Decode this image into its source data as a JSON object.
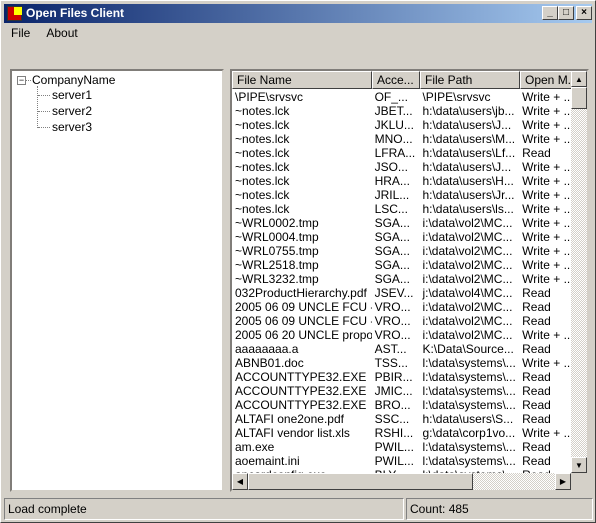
{
  "window": {
    "title": "Open Files Client"
  },
  "menu": [
    {
      "label": "File"
    },
    {
      "label": "About"
    }
  ],
  "tree": {
    "root": "CompanyName",
    "children": [
      "server1",
      "server2",
      "server3"
    ]
  },
  "list": {
    "columns": [
      "File Name",
      "Acce...",
      "File Path",
      "Open M..."
    ],
    "rows": [
      [
        "\\PIPE\\srvsvc",
        "OF_...",
        "\\PIPE\\srvsvc",
        "Write + ..."
      ],
      [
        "~notes.lck",
        "JBET...",
        "h:\\data\\users\\jb...",
        "Write + ..."
      ],
      [
        "~notes.lck",
        "JKLU...",
        "h:\\data\\users\\J...",
        "Write + ..."
      ],
      [
        "~notes.lck",
        "MNO...",
        "h:\\data\\users\\M...",
        "Write + ..."
      ],
      [
        "~notes.lck",
        "LFRA...",
        "h:\\data\\users\\Lf...",
        "Read"
      ],
      [
        "~notes.lck",
        "JSO...",
        "h:\\data\\users\\J...",
        "Write + ..."
      ],
      [
        "~notes.lck",
        "HRA...",
        "h:\\data\\users\\H...",
        "Write + ..."
      ],
      [
        "~notes.lck",
        "JRIL...",
        "h:\\data\\users\\Jr...",
        "Write + ..."
      ],
      [
        "~notes.lck",
        "LSC...",
        "h:\\data\\users\\ls...",
        "Write + ..."
      ],
      [
        "~WRL0002.tmp",
        "SGA...",
        "i:\\data\\vol2\\MC...",
        "Write + ..."
      ],
      [
        "~WRL0004.tmp",
        "SGA...",
        "i:\\data\\vol2\\MC...",
        "Write + ..."
      ],
      [
        "~WRL0755.tmp",
        "SGA...",
        "i:\\data\\vol2\\MC...",
        "Write + ..."
      ],
      [
        "~WRL2518.tmp",
        "SGA...",
        "i:\\data\\vol2\\MC...",
        "Write + ..."
      ],
      [
        "~WRL3232.tmp",
        "SGA...",
        "i:\\data\\vol2\\MC...",
        "Write + ..."
      ],
      [
        "032ProductHierarchy.pdf",
        "JSEV...",
        "j:\\data\\vol4\\MC...",
        "Read"
      ],
      [
        "2005 06 09 UNCLE FCU -...",
        "VRO...",
        "i:\\data\\vol2\\MC...",
        "Read"
      ],
      [
        "2005 06 09 UNCLE FCU -...",
        "VRO...",
        "i:\\data\\vol2\\MC...",
        "Read"
      ],
      [
        "2005 06 20 UNCLE propo...",
        "VRO...",
        "i:\\data\\vol2\\MC...",
        "Write + ..."
      ],
      [
        "aaaaaaaa.a",
        "AST...",
        "K:\\Data\\Source...",
        "Read"
      ],
      [
        "ABNB01.doc",
        "TSS...",
        "l:\\data\\systems\\...",
        "Write + ..."
      ],
      [
        "ACCOUNTTYPE32.EXE",
        "PBIR...",
        "l:\\data\\systems\\...",
        "Read"
      ],
      [
        "ACCOUNTTYPE32.EXE",
        "JMIC...",
        "l:\\data\\systems\\...",
        "Read"
      ],
      [
        "ACCOUNTTYPE32.EXE",
        "BRO...",
        "l:\\data\\systems\\...",
        "Read"
      ],
      [
        "ALTAFI one2one.pdf",
        "SSC...",
        "h:\\data\\users\\S...",
        "Read"
      ],
      [
        "ALTAFI vendor list.xls",
        "RSHI...",
        "g:\\data\\corp1vo...",
        "Write + ..."
      ],
      [
        "am.exe",
        "PWIL...",
        "l:\\data\\systems\\...",
        "Read"
      ],
      [
        "aoemaint.ini",
        "PWIL...",
        "l:\\data\\systems\\...",
        "Read"
      ],
      [
        "apcardconfig.exe",
        "BLY...",
        "l:\\data\\systems\\...",
        "Read"
      ]
    ]
  },
  "status": {
    "message": "Load complete",
    "count": "Count: 485"
  }
}
